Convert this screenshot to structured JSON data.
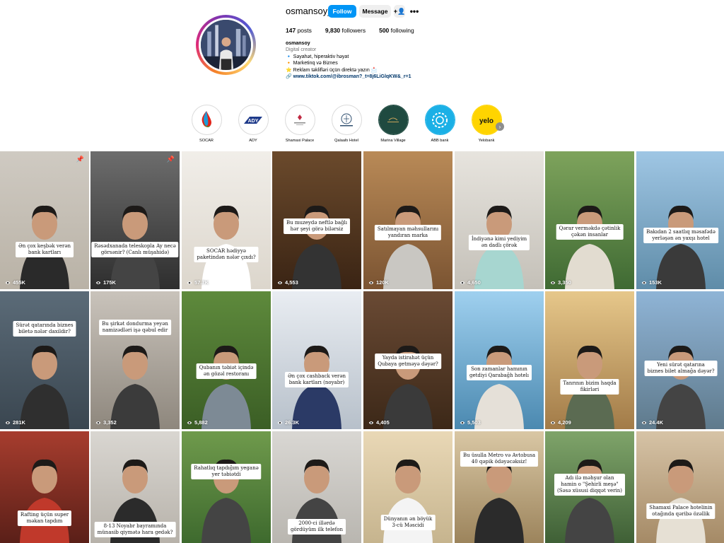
{
  "profile": {
    "username": "osmansoy_",
    "follow_label": "Follow",
    "message_label": "Message",
    "suggest_icon": "person-plus-icon",
    "more_icon": "more-dots-icon",
    "stats": {
      "posts_count": "147",
      "posts_label": "posts",
      "followers_count": "9,830",
      "followers_label": "followers",
      "following_count": "500",
      "following_label": "following"
    },
    "bio": {
      "name": "osmansoy",
      "category": "Digital creator",
      "lines": [
        "🔹 Səyahət, hiperaktiv həyat",
        "🔸 Marketinq və Biznes",
        "⭐ Reklam təklifləri üçün direktə yazın 📩"
      ],
      "link": "🔗 www.tiktok.com/@ibrosman?_t=8j6LiGlqKW&_r=1"
    }
  },
  "highlights": [
    {
      "label": "SOCAR",
      "icon": "socar-flame-logo",
      "bg": "#ffffff"
    },
    {
      "label": "ADY",
      "icon": "ady-logo",
      "bg": "#ffffff"
    },
    {
      "label": "Shamaxi Palace",
      "icon": "shamaxi-palace-logo",
      "bg": "#ffffff"
    },
    {
      "label": "Qalaaltı Hotel",
      "icon": "qalaalti-logo",
      "bg": "#ffffff"
    },
    {
      "label": "Marina Village",
      "icon": "marina-village-logo",
      "bg": "#1f4a40"
    },
    {
      "label": "ABB bank",
      "icon": "abb-logo",
      "bg": "#1bb0e6"
    },
    {
      "label": "Yelobank",
      "icon": "yelo-logo",
      "bg": "#ffd400"
    }
  ],
  "highlights_next_icon": "chevron-right-icon",
  "reels": [
    {
      "caption": "Ən çox keşbək verən\nbank kartları",
      "views": "455K",
      "pinned": true
    },
    {
      "caption": "Rəsədxanada teleskopla Ay necə\ngörsənir? (Canlı müşahidə)",
      "views": "175K",
      "pinned": true
    },
    {
      "caption": "SOCAR hədiyyə\npaketindən nələr çıxdı?",
      "views": "57.7K",
      "pinned": false
    },
    {
      "caption": "Bu muzeydə neftlə bağlı\nhər şeyi görə bilərsiz",
      "views": "4,553",
      "pinned": false
    },
    {
      "caption": "Satılmayan məhsullarını\nyandıran marka",
      "views": "120K",
      "pinned": false
    },
    {
      "caption": "İndiyənə kimi yediyim\nən dadlı çörək",
      "views": "4,650",
      "pinned": false
    },
    {
      "caption": "Qərar verməkdə çətinlik\nçəkən insanlar",
      "views": "3,350",
      "pinned": false
    },
    {
      "caption": "Bakıdan 2 saatlıq məsafədə\nyerləşən ən yaxşı hotel",
      "views": "153K",
      "pinned": false
    },
    {
      "caption": "Sürət qatarında biznes\nbiletə nələr daxildir?",
      "views": "281K",
      "pinned": false
    },
    {
      "caption": "Bu şirkət dondurma yeyən\nnamizədləri işə qəbul edir",
      "views": "3,352",
      "pinned": false
    },
    {
      "caption": "Qubanın təbiət içində\nən gözəl restoranı",
      "views": "5,882",
      "pinned": false
    },
    {
      "caption": "Ən çox cashback verən\nbank kartları (noyabr)",
      "views": "26.3K",
      "pinned": false
    },
    {
      "caption": "Yayda istirahət üçün\nQubaya getməyə dəyər?",
      "views": "4,405",
      "pinned": false
    },
    {
      "caption": "Son zamanlar hamının\ngetdiyi Qarabağh hotelı",
      "views": "5,503",
      "pinned": false
    },
    {
      "caption": "Tanrının bizim haqda\nfikirləri",
      "views": "4,209",
      "pinned": false
    },
    {
      "caption": "Yeni sürət qatarına\nbiznes bilet almağa dəyər?",
      "views": "24.4K",
      "pinned": false
    },
    {
      "caption": "Rafting üçün super\nməkan tapdım",
      "views": "",
      "pinned": false
    },
    {
      "caption": "8-13 Noyabr bayramında\nmünasib qiymətə hara gedək?",
      "views": "",
      "pinned": false
    },
    {
      "caption": "Rahatlıq tapdığım yeganə\nyer təbiətdi",
      "views": "",
      "pinned": false
    },
    {
      "caption": "2000-ci illərdə\ngördüyüm ilk telefon",
      "views": "",
      "pinned": false
    },
    {
      "caption": "Dünyanın ən böyük\n3-cü Məscidi",
      "views": "",
      "pinned": false
    },
    {
      "caption": "Bu üsulla Metro və Avtobusa\n40 qəpik ödəyəcəksiz!",
      "views": "",
      "pinned": false
    },
    {
      "caption": "Adı ilə məhşur olan\nhamin o \"Şehirli meşə\"\n(Səsə xüsusi diqqət verin)",
      "views": "",
      "pinned": false
    },
    {
      "caption": "Shamaxi Palace hotelinin\notağında qəribə özəllik",
      "views": "",
      "pinned": false
    }
  ],
  "view_icon": "play-views-icon",
  "pin_icon": "pin-icon"
}
